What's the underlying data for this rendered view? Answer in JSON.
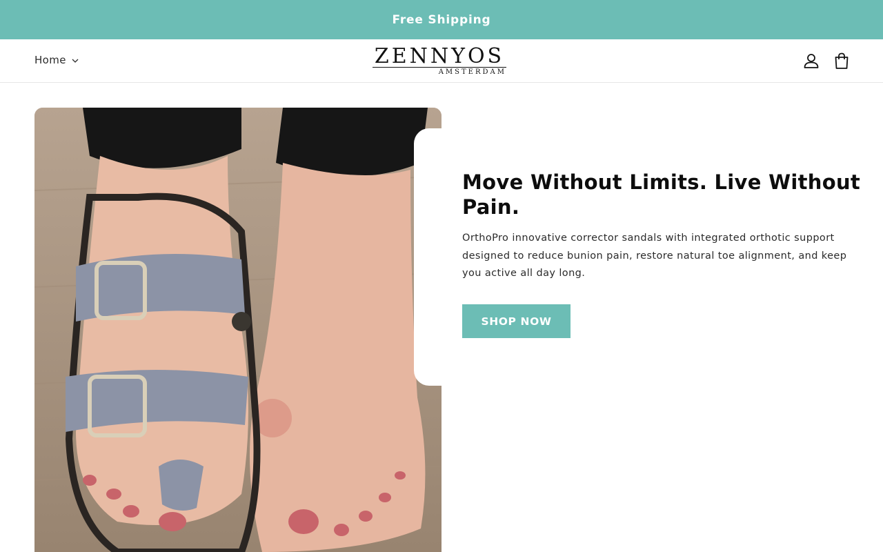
{
  "announcement": {
    "text": "Free Shipping"
  },
  "header": {
    "nav": {
      "home_label": "Home"
    },
    "logo": {
      "brand": "ZENNYOS",
      "subtitle": "AMSTERDAM"
    },
    "icons": {
      "account": "account-icon",
      "cart": "cart-icon"
    }
  },
  "hero": {
    "image": "sandal-on-foot-photo",
    "headline": "Move Without Limits. Live Without Pain.",
    "description": "OrthoPro innovative corrector sandals with integrated orthotic support designed to reduce bunion pain, restore natural toe alignment, and keep you active all day long.",
    "cta_label": "SHOP NOW"
  },
  "colors": {
    "accent": "#6cbdb5",
    "text": "#0d0d0d"
  }
}
